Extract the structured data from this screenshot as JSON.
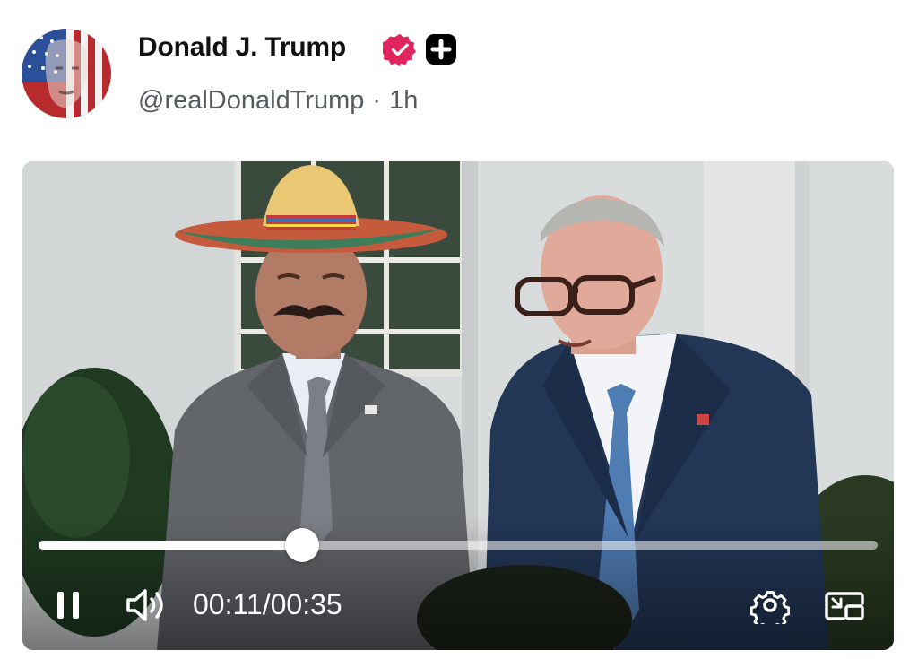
{
  "post": {
    "author": {
      "display_name": "Donald J. Trump",
      "handle": "@realDonaldTrump",
      "separator": "·",
      "time_ago": "1h",
      "verified_icon": "verified-badge-icon",
      "badge_icon": "plus-badge-icon"
    }
  },
  "video": {
    "current_time": "00:11",
    "time_separator": "/",
    "duration": "00:35",
    "progress_fraction": 0.314,
    "icons": {
      "pause": "pause-icon",
      "volume": "volume-icon",
      "settings": "gear-icon",
      "pip": "picture-in-picture-icon"
    }
  },
  "colors": {
    "verified_badge": "#e0245e",
    "plus_badge": "#000000",
    "handle_text": "#555b61"
  }
}
